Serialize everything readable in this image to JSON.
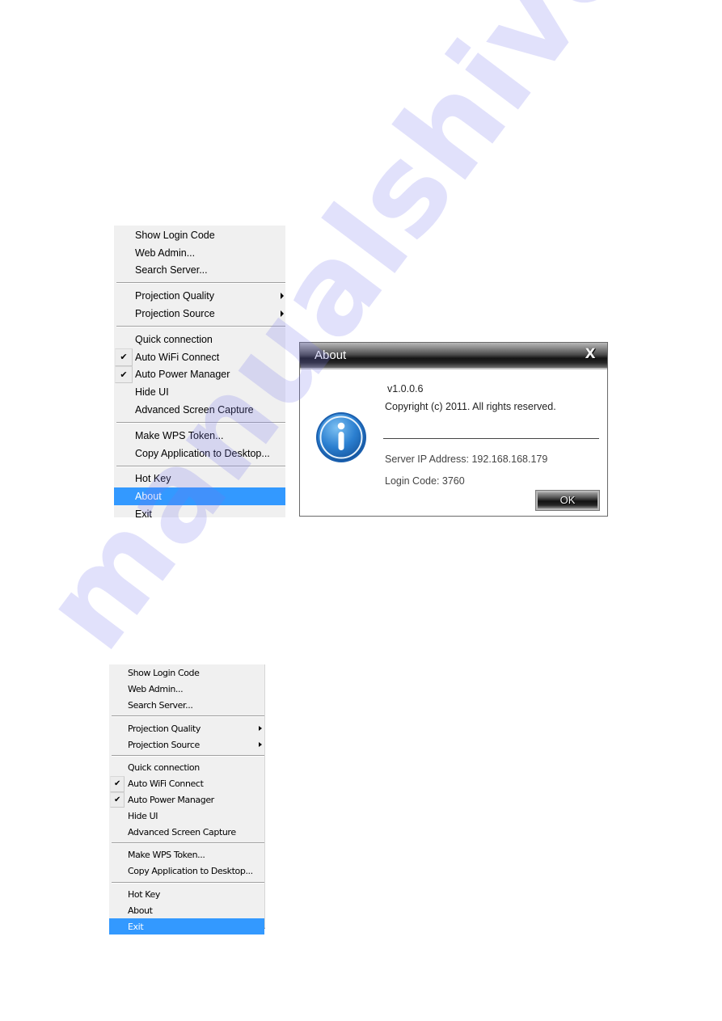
{
  "watermark": {
    "text": "manualshive.com",
    "color": "#7878eb"
  },
  "menu_top": {
    "highlighted_item": "About",
    "highlight_color": "#3399ff",
    "groups": [
      [
        {
          "label": "Show Login Code"
        },
        {
          "label": "Web Admin..."
        },
        {
          "label": "Search Server..."
        }
      ],
      [
        {
          "label": "Projection Quality",
          "submenu": true
        },
        {
          "label": "Projection Source",
          "submenu": true
        }
      ],
      [
        {
          "label": "Quick connection"
        },
        {
          "label": "Auto WiFi Connect",
          "checked": true
        },
        {
          "label": "Auto Power Manager",
          "checked": true
        },
        {
          "label": "Hide UI"
        },
        {
          "label": "Advanced Screen Capture"
        }
      ],
      [
        {
          "label": "Make WPS Token..."
        },
        {
          "label": "Copy Application to Desktop..."
        }
      ],
      [
        {
          "label": "Hot Key"
        },
        {
          "label": "About",
          "highlighted": true
        },
        {
          "label": "Exit"
        }
      ]
    ],
    "check_glyph": "✔"
  },
  "about_dialog": {
    "title": "About",
    "close_glyph": "X",
    "icon": "info-icon",
    "version": "v1.0.0.6",
    "copyright": "Copyright (c) 2011. All rights reserved.",
    "server_ip_label": "Server IP Address: 192.168.168.179",
    "login_code_label": "Login Code: 3760",
    "ok_label": "OK"
  },
  "menu_bottom": {
    "highlighted_item": "Exit",
    "highlight_color": "#3399ff",
    "groups": [
      [
        {
          "label": "Show Login Code"
        },
        {
          "label": "Web Admin..."
        },
        {
          "label": "Search Server..."
        }
      ],
      [
        {
          "label": "Projection Quality",
          "submenu": true
        },
        {
          "label": "Projection Source",
          "submenu": true
        }
      ],
      [
        {
          "label": "Quick connection"
        },
        {
          "label": "Auto WiFi Connect",
          "checked": true
        },
        {
          "label": "Auto Power Manager",
          "checked": true
        },
        {
          "label": "Hide UI"
        },
        {
          "label": "Advanced Screen Capture"
        }
      ],
      [
        {
          "label": "Make WPS Token..."
        },
        {
          "label": "Copy Application to Desktop..."
        }
      ],
      [
        {
          "label": "Hot Key"
        },
        {
          "label": "About"
        },
        {
          "label": "Exit",
          "highlighted": true
        }
      ]
    ],
    "check_glyph": "✔"
  }
}
